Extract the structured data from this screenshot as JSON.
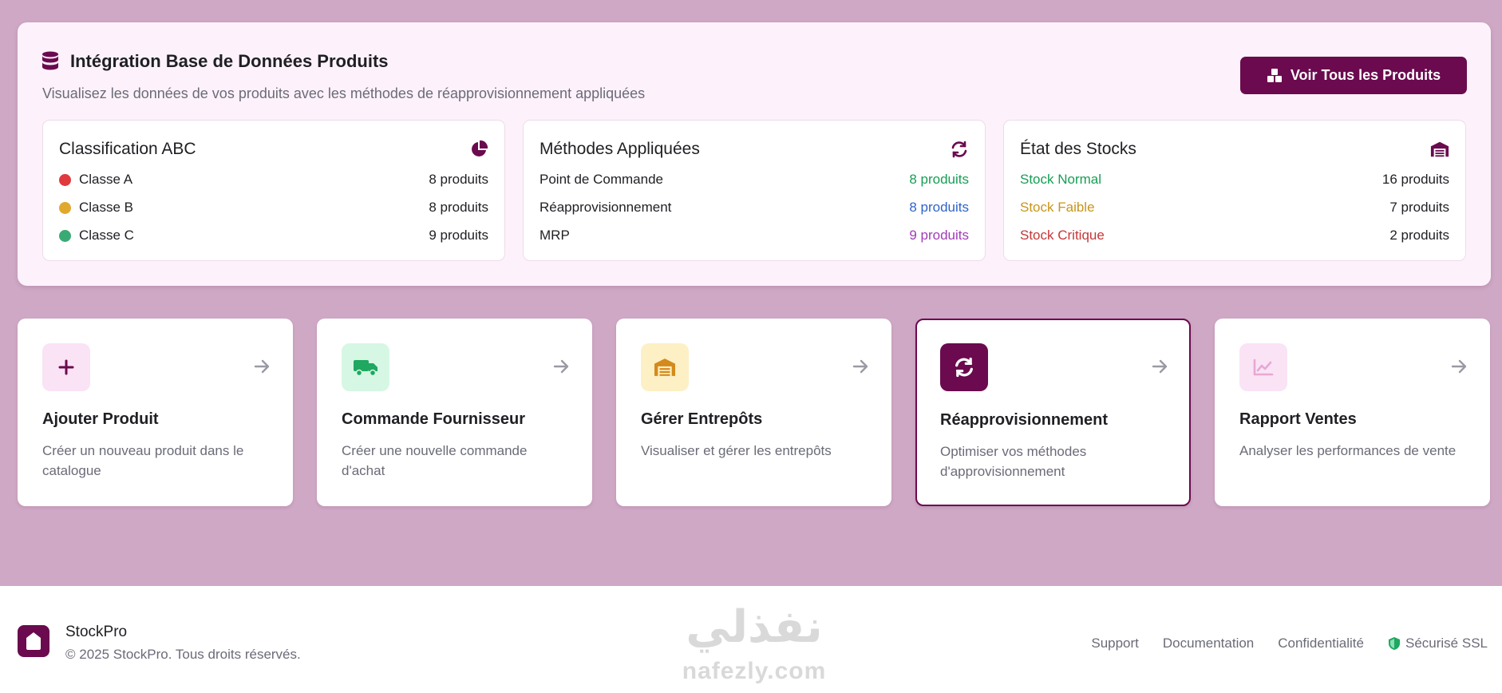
{
  "integration": {
    "title": "Intégration Base de Données Produits",
    "subtitle": "Visualisez les données de vos produits avec les méthodes de réapprovisionnement appliquées",
    "view_all_label": "Voir Tous les Produits"
  },
  "abc": {
    "title": "Classification ABC",
    "rows": [
      {
        "label": "Classe A",
        "value": "8 produits",
        "color": "#e0393e"
      },
      {
        "label": "Classe B",
        "value": "8 produits",
        "color": "#e0a82e"
      },
      {
        "label": "Classe C",
        "value": "9 produits",
        "color": "#3aaa74"
      }
    ]
  },
  "methods": {
    "title": "Méthodes Appliquées",
    "rows": [
      {
        "label": "Point de Commande",
        "value": "8 produits",
        "color": "#169e55"
      },
      {
        "label": "Réapprovisionnement",
        "value": "8 produits",
        "color": "#2f64c8"
      },
      {
        "label": "MRP",
        "value": "9 produits",
        "color": "#a23bb8"
      }
    ]
  },
  "stocks": {
    "title": "État des Stocks",
    "rows": [
      {
        "label": "Stock Normal",
        "value": "16 produits",
        "color": "#169e55"
      },
      {
        "label": "Stock Faible",
        "value": "7 produits",
        "color": "#c9951a"
      },
      {
        "label": "Stock Critique",
        "value": "2 produits",
        "color": "#c63838"
      }
    ]
  },
  "actions": [
    {
      "title": "Ajouter Produit",
      "desc": "Créer un nouveau produit dans le catalogue",
      "icon": "plus-icon",
      "bg": "#fae3f4",
      "fg": "#6b0a4e"
    },
    {
      "title": "Commande Fournisseur",
      "desc": "Créer une nouvelle commande d'achat",
      "icon": "truck-icon",
      "bg": "#d6f7e4",
      "fg": "#1ea860"
    },
    {
      "title": "Gérer Entrepôts",
      "desc": "Visualiser et gérer les entrepôts",
      "icon": "warehouse-icon",
      "bg": "#fdf0c4",
      "fg": "#d48a1c"
    },
    {
      "title": "Réapprovisionnement",
      "desc": "Optimiser vos méthodes d'approvisionnement",
      "icon": "sync-icon",
      "bg": "#6b0a4e",
      "fg": "#ffffff"
    },
    {
      "title": "Rapport Ventes",
      "desc": "Analyser les performances de vente",
      "icon": "chart-line-icon",
      "bg": "#fae3f4",
      "fg": "#e6a8d6"
    }
  ],
  "footer": {
    "brand": "StockPro",
    "copyright": "© 2025 StockPro. Tous droits réservés.",
    "links": [
      "Support",
      "Documentation",
      "Confidentialité"
    ],
    "secure_label": "Sécurisé SSL",
    "watermark_ar": "نفذلي",
    "watermark_en": "nafezly.com"
  },
  "colors": {
    "accent": "#6b0a4e",
    "page_bg": "#cfa8c5"
  }
}
